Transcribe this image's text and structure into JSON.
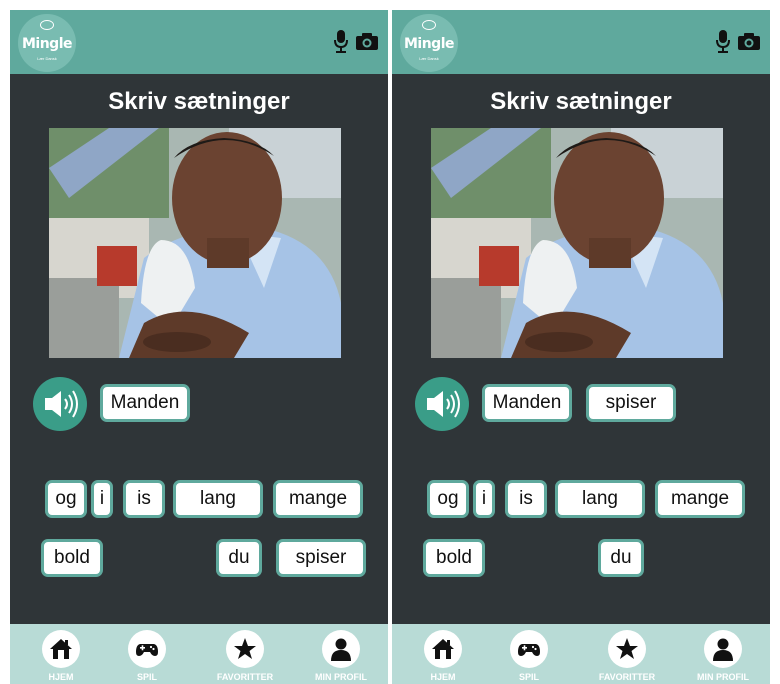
{
  "app": {
    "logo_title": "Mingle",
    "logo_subtitle": "Lær Dansk"
  },
  "colors": {
    "header": "#5fa99d",
    "background": "#2f3538",
    "accent": "#3a9d88",
    "chip_border": "#5fa99d",
    "bottom_nav": "#b8dbd6"
  },
  "screens": [
    {
      "title": "Skriv sætninger",
      "sentence_words": [
        "Manden"
      ],
      "word_bank": [
        "og",
        "i",
        "is",
        "lang",
        "mange",
        "bold",
        "du",
        "spiser"
      ]
    },
    {
      "title": "Skriv sætninger",
      "sentence_words": [
        "Manden",
        "spiser"
      ],
      "word_bank": [
        "og",
        "i",
        "is",
        "lang",
        "mange",
        "bold",
        "du"
      ]
    }
  ],
  "nav": [
    {
      "label": "HJEM",
      "icon": "home-icon"
    },
    {
      "label": "SPIL",
      "icon": "gamepad-icon"
    },
    {
      "label": "FAVORITTER",
      "icon": "star-icon"
    },
    {
      "label": "MIN PROFIL",
      "icon": "profile-icon"
    }
  ],
  "header_icons": [
    "microphone-icon",
    "camera-icon"
  ],
  "speaker_icon": "speaker-icon"
}
